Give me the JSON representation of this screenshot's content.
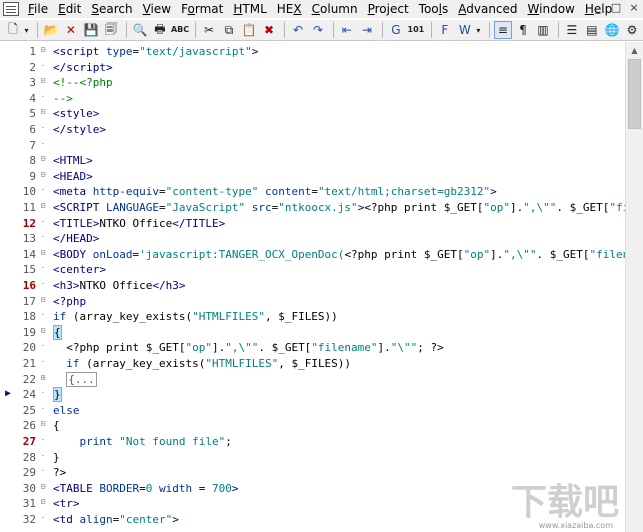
{
  "menu": {
    "items": [
      {
        "label": "File",
        "key": "F"
      },
      {
        "label": "Edit",
        "key": "E"
      },
      {
        "label": "Search",
        "key": "S"
      },
      {
        "label": "View",
        "key": "V"
      },
      {
        "label": "Format",
        "key": "o"
      },
      {
        "label": "HTML",
        "key": "H"
      },
      {
        "label": "HEX",
        "key": "X"
      },
      {
        "label": "Column",
        "key": "C"
      },
      {
        "label": "Project",
        "key": "P"
      },
      {
        "label": "Tools",
        "key": "l"
      },
      {
        "label": "Advanced",
        "key": "A"
      },
      {
        "label": "Window",
        "key": "W"
      },
      {
        "label": "Help",
        "key": "H"
      }
    ],
    "window_controls": [
      "_",
      "□",
      "×"
    ]
  },
  "toolbar": {
    "buttons": [
      {
        "icon": "new-document-icon",
        "glyph": "🗋"
      },
      {
        "icon": "dropdown-arrow-icon",
        "glyph": "▾"
      },
      {
        "icon": "open-folder-icon",
        "glyph": "📂"
      },
      {
        "icon": "close-icon",
        "glyph": "✕"
      },
      {
        "icon": "save-icon",
        "glyph": "💾"
      },
      {
        "icon": "save-all-icon",
        "glyph": "🗐"
      },
      {
        "icon": "print-preview-icon",
        "glyph": "🔍"
      },
      {
        "icon": "print-icon",
        "glyph": "🖶"
      },
      {
        "icon": "spell-check-icon",
        "glyph": "ABC"
      },
      {
        "icon": "cut-icon",
        "glyph": "✂"
      },
      {
        "icon": "copy-icon",
        "glyph": "⧉"
      },
      {
        "icon": "paste-icon",
        "glyph": "📋"
      },
      {
        "icon": "delete-icon",
        "glyph": "✖"
      },
      {
        "icon": "undo-icon",
        "glyph": "↶"
      },
      {
        "icon": "redo-icon",
        "glyph": "↷"
      },
      {
        "icon": "indent-icon",
        "glyph": "⇤"
      },
      {
        "icon": "outdent-icon",
        "glyph": "⇥"
      },
      {
        "icon": "goto-icon",
        "glyph": "G"
      },
      {
        "icon": "hex-mode-icon",
        "glyph": "101"
      },
      {
        "icon": "font-icon",
        "glyph": "F"
      },
      {
        "icon": "word-wrap-icon",
        "glyph": "W"
      },
      {
        "icon": "word-wrap-dropdown-icon",
        "glyph": "▾"
      },
      {
        "icon": "line-numbers-icon",
        "glyph": "≡"
      },
      {
        "icon": "show-spaces-icon",
        "glyph": "¶"
      },
      {
        "icon": "column-mode-icon",
        "glyph": "▥"
      },
      {
        "icon": "list-icon",
        "glyph": "☰"
      },
      {
        "icon": "function-list-icon",
        "glyph": "▤"
      },
      {
        "icon": "web-preview-icon",
        "glyph": "🌐"
      },
      {
        "icon": "settings-icon",
        "glyph": "⚙"
      }
    ]
  },
  "editor": {
    "current_line": 24,
    "lines": [
      {
        "n": "1",
        "fold": "⊟",
        "html": "<span class='h'>&lt;script</span> <span class='k'>type</span>=<span class='s'>\"text/javascript\"</span><span class='h'>&gt;</span>"
      },
      {
        "n": "2",
        "fold": "",
        "html": "<span class='h'>&lt;/script&gt;</span>"
      },
      {
        "n": "3",
        "fold": "⊟",
        "html": "<span class='c'>&lt;!--&lt;?php</span>"
      },
      {
        "n": "4",
        "fold": "",
        "html": "<span class='c'>--&gt;</span>"
      },
      {
        "n": "5",
        "fold": "⊟",
        "html": "<span class='h'>&lt;style&gt;</span>"
      },
      {
        "n": "6",
        "fold": "",
        "html": "<span class='h'>&lt;/style&gt;</span>"
      },
      {
        "n": "7",
        "fold": "",
        "html": ""
      },
      {
        "n": "8",
        "fold": "⊟",
        "html": "<span class='h'>&lt;HTML&gt;</span>"
      },
      {
        "n": "9",
        "fold": "⊟",
        "html": "<span class='h'>&lt;HEAD&gt;</span>"
      },
      {
        "n": "10",
        "fold": "",
        "html": "<span class='h'>&lt;meta</span> <span class='k'>http-equiv</span>=<span class='s'>\"content-type\"</span> <span class='k'>content</span>=<span class='s'>\"text/html;charset=gb2312\"</span><span class='h'>&gt;</span>"
      },
      {
        "n": "11",
        "fold": "⊟",
        "html": "<span class='h'>&lt;SCRIPT</span> <span class='k'>LANGUAGE</span>=<span class='s'>\"JavaScript\"</span> <span class='k'>src</span>=<span class='s'>\"ntkoocx.js\"</span><span class='h'>&gt;</span>&lt;?php print $_GET[<span class='s'>\"op\"</span>].<span class='s'>\",\\\"\"</span>. $_GET[<span class='s'>\"fi</span>"
      },
      {
        "n": "12",
        "red": true,
        "fold": "",
        "html": "<span class='h'>&lt;TITLE&gt;</span>NTKO Office<span class='h'>&lt;/TITLE&gt;</span>"
      },
      {
        "n": "13",
        "fold": "",
        "html": "<span class='h'>&lt;/HEAD&gt;</span>"
      },
      {
        "n": "14",
        "fold": "⊟",
        "html": "<span class='h'>&lt;BODY</span> <span class='k'>onLoad</span>=<span class='s'>'javascript:TANGER_OCX_OpenDoc(</span>&lt;?php print $_GET[<span class='s'>\"op\"</span>].<span class='s'>\",\\\"\"</span>. $_GET[<span class='s'>\"filen</span>"
      },
      {
        "n": "15",
        "fold": "",
        "html": "<span class='h'>&lt;center&gt;</span>"
      },
      {
        "n": "16",
        "red": true,
        "fold": "",
        "html": "<span class='h'>&lt;h3&gt;</span>NTKO Office<span class='h'>&lt;/h3&gt;</span>"
      },
      {
        "n": "17",
        "fold": "⊟",
        "html": "<span class='h'>&lt;?php</span>"
      },
      {
        "n": "18",
        "fold": "",
        "html": "<span class='k'>if</span> (array_key_exists(<span class='s'>\"HTMLFILES\"</span>, $_FILES))"
      },
      {
        "n": "19",
        "fold": "⊟",
        "html": "<span class='brace-hl'>{</span>"
      },
      {
        "n": "20",
        "fold": "",
        "html": "  &lt;?php print $_GET[<span class='s'>\"op\"</span>].<span class='s'>\",\\\"\"</span>. $_GET[<span class='s'>\"filename\"</span>].<span class='s'>\"\\\"\"</span>; ?&gt;"
      },
      {
        "n": "21",
        "fold": "",
        "html": "  <span class='k'>if</span> (array_key_exists(<span class='s'>\"HTMLFILES\"</span>, $_FILES))"
      },
      {
        "n": "22",
        "fold": "⊞",
        "html": "  <span class='collapsed'>{...</span>"
      },
      {
        "n": "24",
        "fold": "",
        "html": "<span class='brace-hl'>}</span>"
      },
      {
        "n": "25",
        "fold": "",
        "html": "<span class='k'>else</span>"
      },
      {
        "n": "26",
        "fold": "⊟",
        "html": "{"
      },
      {
        "n": "27",
        "red": true,
        "fold": "",
        "html": "    <span class='k'>print</span> <span class='s'>\"Not found file\"</span>;"
      },
      {
        "n": "28",
        "fold": "",
        "html": "}"
      },
      {
        "n": "29",
        "fold": "",
        "html": "?&gt;"
      },
      {
        "n": "30",
        "fold": "⊟",
        "html": "<span class='h'>&lt;TABLE</span> <span class='k'>BORDER</span>=<span class='s'>0</span> <span class='k'>width</span> = <span class='s'>700</span><span class='h'>&gt;</span>"
      },
      {
        "n": "31",
        "fold": "⊟",
        "html": "<span class='h'>&lt;tr&gt;</span>"
      },
      {
        "n": "32",
        "fold": "",
        "html": "<span class='h'>&lt;td</span> <span class='k'>align</span>=<span class='s'>\"center\"</span><span class='h'>&gt;</span>"
      }
    ]
  },
  "watermark": {
    "text": "www.xiazaiba.com"
  }
}
